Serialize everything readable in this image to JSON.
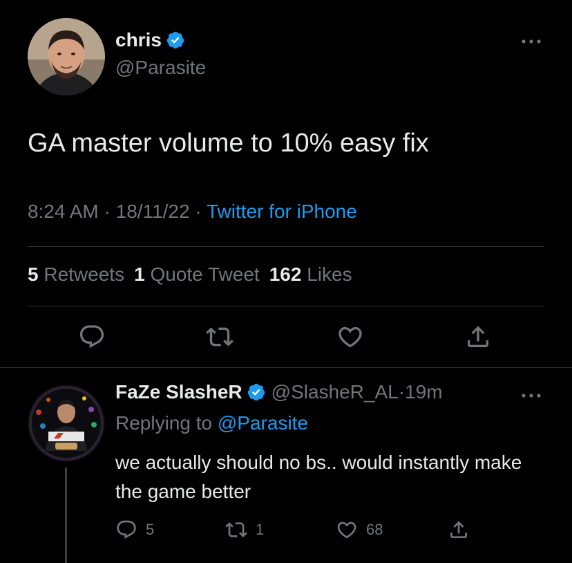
{
  "tweet": {
    "author": {
      "display_name": "chris",
      "handle": "@Parasite",
      "verified": true
    },
    "text": "GA master volume to 10% easy fix",
    "time": "8:24 AM",
    "date": "18/11/22",
    "separator": " · ",
    "source": "Twitter for iPhone",
    "stats": {
      "retweets_count": "5",
      "retweets_label": "Retweets",
      "quotes_count": "1",
      "quotes_label": "Quote Tweet",
      "likes_count": "162",
      "likes_label": "Likes"
    },
    "actions": [
      "reply-icon",
      "retweet-icon",
      "like-icon",
      "share-icon"
    ]
  },
  "reply": {
    "author": {
      "display_name": "FaZe SlasheR",
      "handle": "@SlasheR_AL",
      "verified": true
    },
    "time_separator": " · ",
    "time_ago": "19m",
    "replying_prefix": "Replying to ",
    "replying_to": "@Parasite",
    "text": "we actually should no bs.. would instantly make the game better",
    "counts": {
      "replies": "5",
      "retweets": "1",
      "likes": "68"
    }
  },
  "colors": {
    "background": "#000000",
    "text_primary": "#e7e9ea",
    "text_secondary": "#71767b",
    "accent": "#1d9bf0",
    "divider": "#2f3336"
  }
}
